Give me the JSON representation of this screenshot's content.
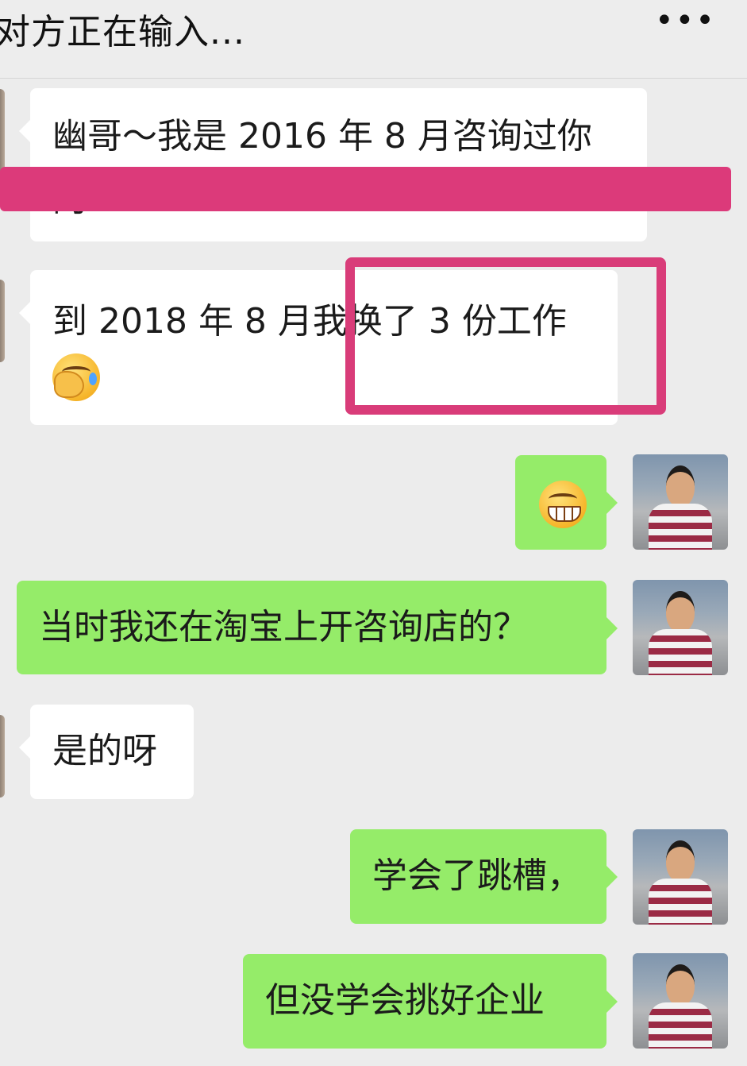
{
  "header": {
    "title": "对方正在输入...",
    "more_icon": "more-dots-icon",
    "more_glyph": "•••"
  },
  "messages": [
    {
      "side": "in",
      "line1": "幽哥～我是 2016 年 8 月咨询过你",
      "line2": "的"
    },
    {
      "side": "in",
      "text": "到 2018 年 8 月我换了 3 份工作",
      "emoji": "facepalm-emoji"
    },
    {
      "side": "out",
      "emoji": "grin-emoji"
    },
    {
      "side": "out",
      "text": "当时我还在淘宝上开咨询店的？"
    },
    {
      "side": "in",
      "text": "是的呀"
    },
    {
      "side": "out",
      "text": "学会了跳槽，"
    },
    {
      "side": "out",
      "text": "但没学会挑好企业"
    }
  ],
  "colors": {
    "background": "#ececec",
    "incoming_bubble": "#ffffff",
    "outgoing_bubble": "#95ec69",
    "annotation": "#dc3a7a"
  }
}
